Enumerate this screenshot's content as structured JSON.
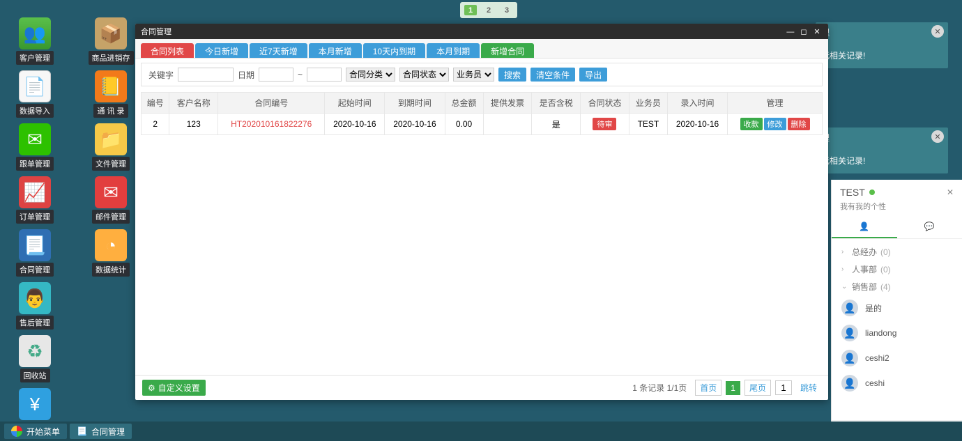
{
  "top_buttons": [
    "1",
    "2",
    "3"
  ],
  "desktop_icons": {
    "col1": [
      {
        "label": "客户管理",
        "cls": "green",
        "glyph": "👥"
      },
      {
        "label": "数据导入",
        "cls": "doc",
        "glyph": "📄"
      },
      {
        "label": "跟单管理",
        "cls": "wechat",
        "glyph": "✉"
      },
      {
        "label": "订单管理",
        "cls": "chart",
        "glyph": "📈"
      },
      {
        "label": "合同管理",
        "cls": "contract",
        "glyph": "📃"
      },
      {
        "label": "售后管理",
        "cls": "person",
        "glyph": "👨"
      },
      {
        "label": "回收站",
        "cls": "trash",
        "glyph": "♻"
      },
      {
        "label": "财务管理",
        "cls": "money",
        "glyph": "¥"
      }
    ],
    "col2": [
      {
        "label": "商品进销存",
        "cls": "box",
        "glyph": "📦"
      },
      {
        "label": "通 讯 录",
        "cls": "orange",
        "glyph": "📒"
      },
      {
        "label": "文件管理",
        "cls": "folder",
        "glyph": "📁"
      },
      {
        "label": "邮件管理",
        "cls": "mail",
        "glyph": "✉"
      },
      {
        "label": "数据统计",
        "cls": "pie",
        "glyph": "◔"
      }
    ]
  },
  "notifications": {
    "n1": {
      "title": "理",
      "body": "无相关记录!"
    },
    "n2": {
      "title": "理",
      "body": "无相关记录!"
    }
  },
  "window": {
    "title": "合同管理",
    "tabs": [
      "合同列表",
      "今日新增",
      "近7天新增",
      "本月新增",
      "10天内到期",
      "本月到期",
      "新增合同"
    ],
    "filters": {
      "kw_label": "关键字",
      "date_label": "日期",
      "tilde": "~",
      "sel1": "合同分类",
      "sel2": "合同状态",
      "sel3": "业务员",
      "search": "搜索",
      "clear": "清空条件",
      "export": "导出"
    },
    "columns": [
      "编号",
      "客户名称",
      "合同编号",
      "起始时间",
      "到期时间",
      "总金额",
      "提供发票",
      "是否含税",
      "合同状态",
      "业务员",
      "录入时间",
      "管理"
    ],
    "rows": [
      {
        "id": "2",
        "cust": "123",
        "ct": "HT202010161822276",
        "start": "2020-10-16",
        "end": "2020-10-16",
        "amt": "0.00",
        "invoice": "",
        "tax": "是",
        "status": "待审",
        "staff": "TEST",
        "created": "2020-10-16"
      }
    ],
    "actions": {
      "pay": "收款",
      "edit": "修改",
      "del": "删除"
    },
    "custom": "自定义设置",
    "pager": {
      "summary": "1 条记录 1/1页",
      "first": "首页",
      "current": "1",
      "last": "尾页",
      "goto": "1",
      "jump": "跳转"
    }
  },
  "chat": {
    "name": "TEST",
    "status": "我有我的个性",
    "groups": [
      {
        "name": "总经办",
        "count": "(0)",
        "open": false
      },
      {
        "name": "人事部",
        "count": "(0)",
        "open": false
      },
      {
        "name": "销售部",
        "count": "(4)",
        "open": true
      }
    ],
    "members": [
      "是的",
      "liandong",
      "ceshi2",
      "ceshi"
    ]
  },
  "taskbar": {
    "start": "开始菜单",
    "task1": "合同管理"
  }
}
